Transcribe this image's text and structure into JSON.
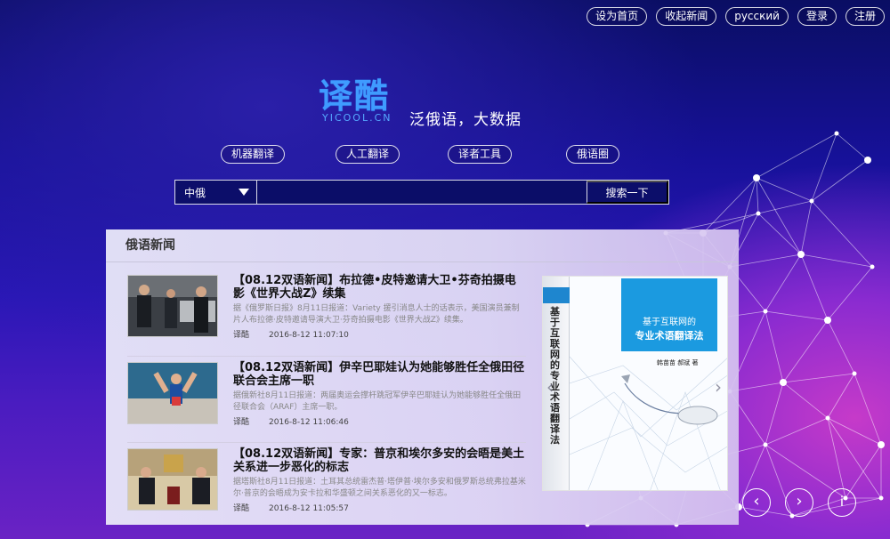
{
  "topnav": {
    "set_home": "设为首页",
    "bookmark": "收起新闻",
    "russian": "русский",
    "login": "登录",
    "register": "注册"
  },
  "logo": {
    "glyphs": "译酷",
    "url": "YICOOL.CN"
  },
  "slogan": "泛俄语，大数据",
  "tools": [
    "机器翻译",
    "人工翻译",
    "译者工具",
    "俄语圈"
  ],
  "search": {
    "lang": "中俄",
    "value": "",
    "button": "搜索一下"
  },
  "news": {
    "header": "俄语新闻",
    "items": [
      {
        "title": "【08.12双语新闻】布拉德•皮特邀请大卫•芬奇拍摄电影《世界大战Z》续集",
        "summary": "据《俄罗斯日报》8月11日报道：Variety 援引消息人士的话表示，美国演员兼制片人布拉德·皮特邀请导演大卫·芬奇拍摄电影《世界大战Z》续集。",
        "source": "译酷",
        "time": "2016-8-12 11:07:10"
      },
      {
        "title": "【08.12双语新闻】伊辛巴耶娃认为她能够胜任全俄田径联合会主席一职",
        "summary": "据俄新社8月11日报道：两届奥运会撑杆跳冠军伊辛巴耶娃认为她能够胜任全俄田径联合会（ARAF）主席一职。",
        "source": "译酷",
        "time": "2016-8-12 11:06:46"
      },
      {
        "title": "【08.12双语新闻】专家：普京和埃尔多安的会晤是美土关系进一步恶化的标志",
        "summary": "据塔斯社8月11日报道：土耳其总统雷杰普·塔伊普·埃尔多安和俄罗斯总统弗拉基米尔·普京的会晤成为安卡拉和华盛顿之间关系恶化的又一标志。",
        "source": "译酷",
        "time": "2016-8-12 11:05:57"
      }
    ]
  },
  "book": {
    "spine_title": "基于互联网的专业术语翻译法",
    "cover_line1": "基于互联网的",
    "cover_line2": "专业术语翻译法",
    "authors": "韩苗苗 郝斌 著"
  },
  "controls": {
    "prev": "‹",
    "next": "›",
    "info": "i"
  },
  "colors": {
    "accent": "#3f9bff",
    "bg_dark": "#0a0e63",
    "bg_purple": "#c63ac9"
  }
}
